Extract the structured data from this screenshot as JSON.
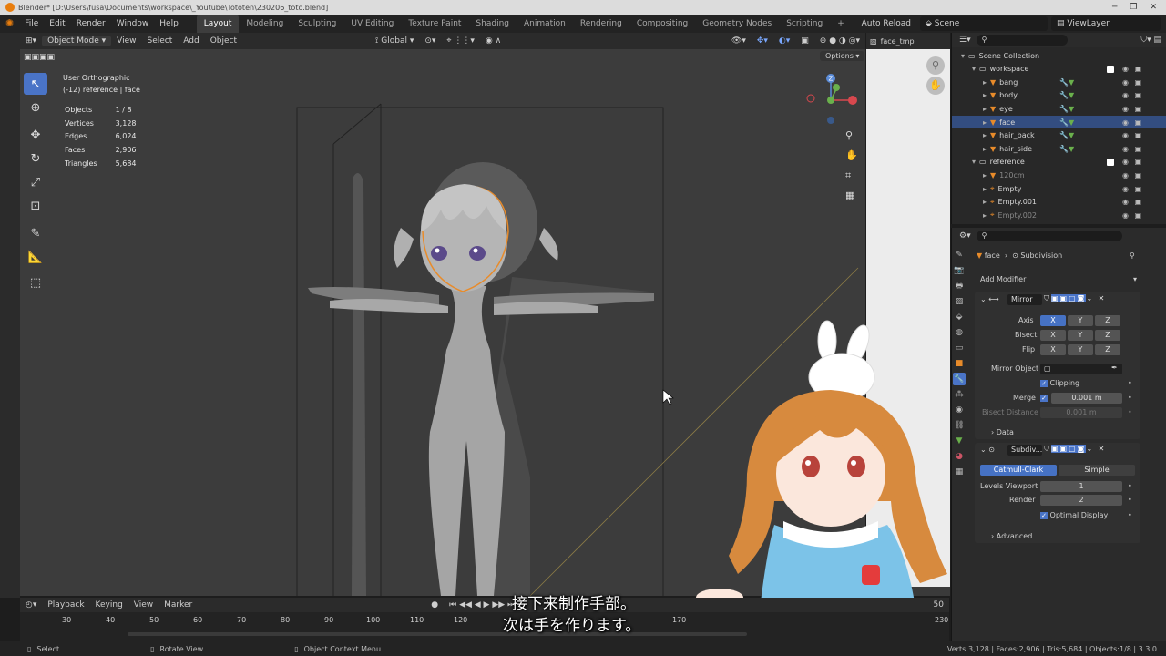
{
  "window": {
    "title": "Blender* [D:\\Users\\fusa\\Documents\\workspace\\_Youtube\\Tototen\\230206_toto.blend]"
  },
  "menu": {
    "items": [
      "File",
      "Edit",
      "Render",
      "Window",
      "Help"
    ],
    "workspaces": [
      "Layout",
      "Modeling",
      "Sculpting",
      "UV Editing",
      "Texture Paint",
      "Shading",
      "Animation",
      "Rendering",
      "Compositing",
      "Geometry Nodes",
      "Scripting"
    ],
    "active_workspace": "Layout",
    "add_tab": "+",
    "auto_reload": "Auto Reload",
    "scene": "Scene",
    "view_layer": "ViewLayer"
  },
  "viewport_header": {
    "mode": "Object Mode",
    "view": "View",
    "select": "Select",
    "add": "Add",
    "object": "Object",
    "transform": "Global",
    "options": "Options"
  },
  "viewport": {
    "view_name": "User Orthographic",
    "context": "(-12) reference | face",
    "stats": [
      {
        "label": "Objects",
        "value": "1 / 8"
      },
      {
        "label": "Vertices",
        "value": "3,128"
      },
      {
        "label": "Edges",
        "value": "6,024"
      },
      {
        "label": "Faces",
        "value": "2,906"
      },
      {
        "label": "Triangles",
        "value": "5,684"
      }
    ]
  },
  "image_editor": {
    "image_name": "face_tmp"
  },
  "outliner": {
    "rows": [
      {
        "name": "Scene Collection",
        "level": 0,
        "type": "collection",
        "selected": false
      },
      {
        "name": "workspace",
        "level": 1,
        "type": "collection",
        "selected": false
      },
      {
        "name": "bang",
        "level": 2,
        "type": "mesh",
        "selected": false
      },
      {
        "name": "body",
        "level": 2,
        "type": "mesh",
        "selected": false
      },
      {
        "name": "eye",
        "level": 2,
        "type": "mesh",
        "selected": false
      },
      {
        "name": "face",
        "level": 2,
        "type": "mesh",
        "selected": true
      },
      {
        "name": "hair_back",
        "level": 2,
        "type": "mesh",
        "selected": false
      },
      {
        "name": "hair_side",
        "level": 2,
        "type": "mesh",
        "selected": false
      },
      {
        "name": "reference",
        "level": 1,
        "type": "collection",
        "selected": false
      },
      {
        "name": "120cm",
        "level": 2,
        "type": "mesh",
        "selected": false
      },
      {
        "name": "Empty",
        "level": 2,
        "type": "empty",
        "selected": false
      },
      {
        "name": "Empty.001",
        "level": 2,
        "type": "empty",
        "selected": false
      },
      {
        "name": "Empty.002",
        "level": 2,
        "type": "empty",
        "selected": false
      }
    ]
  },
  "properties": {
    "breadcrumb_object": "face",
    "breadcrumb_modifier": "Subdivision",
    "add_modifier": "Add Modifier",
    "mirror": {
      "name": "Mirror",
      "axis_label": "Axis",
      "bisect_label": "Bisect",
      "flip_label": "Flip",
      "x": "X",
      "y": "Y",
      "z": "Z",
      "mirror_object_label": "Mirror Object",
      "clipping_label": "Clipping",
      "merge_label": "Merge",
      "merge_value": "0.001 m",
      "bisect_distance_label": "Bisect Distance",
      "bisect_distance_value": "0.001 m",
      "data_label": "Data"
    },
    "subdivision": {
      "name": "Subdiv...",
      "catmull": "Catmull-Clark",
      "simple": "Simple",
      "levels_viewport_label": "Levels Viewport",
      "levels_viewport_value": "1",
      "render_label": "Render",
      "render_value": "2",
      "optimal_display_label": "Optimal Display",
      "advanced_label": "Advanced"
    }
  },
  "timeline": {
    "playback": "Playback",
    "keying": "Keying",
    "view": "View",
    "marker": "Marker",
    "frame_numbers": [
      "30",
      "40",
      "50",
      "60",
      "70",
      "80",
      "90",
      "100",
      "110",
      "120",
      "170",
      "230"
    ],
    "end_frame": "50"
  },
  "status_bar": {
    "select": "Select",
    "rotate": "Rotate View",
    "context_menu": "Object Context Menu",
    "stats": "Verts:3,128 | Faces:2,906 | Tris:5,684 | Objects:1/8 | 3.3.0"
  },
  "subtitles": {
    "line1": "接下来制作手部。",
    "line2": "次は手を作ります。"
  },
  "colors": {
    "accent": "#4a74c7",
    "selection_outline": "#e88b2a",
    "viewport_bg": "#3c3c3c"
  }
}
